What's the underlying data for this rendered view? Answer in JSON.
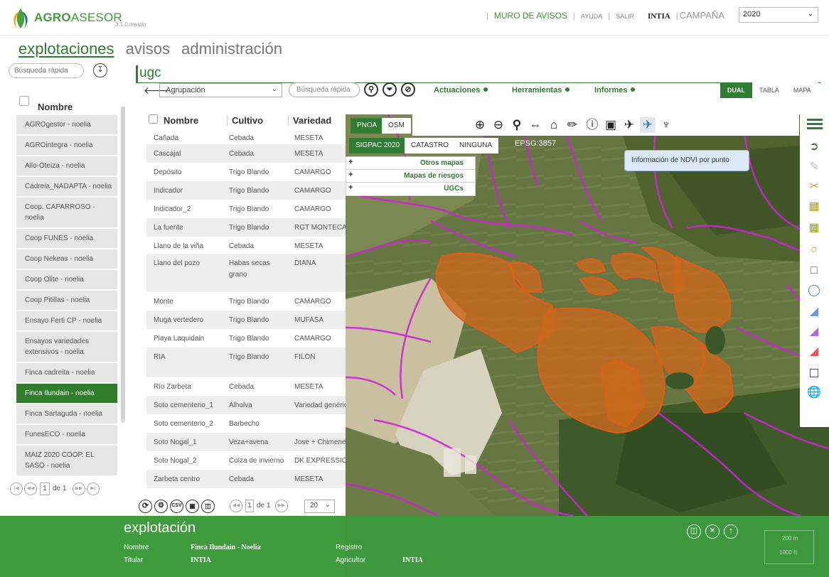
{
  "app": {
    "brand_bold": "AGRO",
    "brand_rest": "ASESOR",
    "version": "3.1.0.mastin"
  },
  "topnav": {
    "muro": "MURO DE AVISOS",
    "ayuda": "AYUDA",
    "salir": "SALIR",
    "org": "INTIA",
    "campaign_label": "CAMPAÑA",
    "campaign_value": "2020",
    "sep": "|"
  },
  "mainnav": {
    "items": [
      "explotaciones",
      "avisos",
      "administración"
    ],
    "active": "explotaciones"
  },
  "left": {
    "search_placeholder": "Búsqueda rápida",
    "header": "Nombre",
    "items": [
      "AGROgestor - noelia",
      "AGROintegra - noelia",
      "Allo-Oteiza - noelia",
      "Cadreia_NADAPTA - noelia",
      "Coop. CAPARROSO - noelia",
      "Coop FUNES - noelia",
      "Coop Nekeas - noelia",
      "Coop Olite - noelia",
      "Coop Pitillas - noelia",
      "Ensayo Ferti CP - noelia",
      "Ensayos variedades extensivos - noelia",
      "Finca cadreita - noelia",
      "Finca Ilundain - noelia",
      "Finca Sartaguda - noelia",
      "FunesECO - noelia",
      "MAIZ 2020 COOP. EL SASO - noelia"
    ],
    "active_index": 12,
    "pager": {
      "page": "1",
      "of_label": "de 1"
    }
  },
  "content": {
    "title": "ugc",
    "agrupacion": "Agrupación",
    "search_placeholder": "Búsqueda rápida",
    "menus": [
      "Actuaciones",
      "Herramientas",
      "Informes"
    ],
    "views": [
      "DUAL",
      "TABLA",
      "MAPA"
    ],
    "active_view": "DUAL"
  },
  "table": {
    "headers": [
      "Nombre",
      "Cultivo",
      "Variedad"
    ],
    "rows": [
      [
        "Cañada",
        "Cebada",
        "MESETA"
      ],
      [
        "Cascajal",
        "Cebada",
        "MESETA"
      ],
      [
        "Depósito",
        "Trigo Blando",
        "CAMARGO"
      ],
      [
        "Indicador",
        "Trigo Blando",
        "CAMARGO"
      ],
      [
        "Indicador_2",
        "Trigo Blando",
        "CAMARGO"
      ],
      [
        "La fuente",
        "Trigo Blando",
        "RGT MONTECARLO"
      ],
      [
        "Llano de la viña",
        "Cebada",
        "MESETA"
      ],
      [
        "Llano del pozo",
        "Habas secas grano",
        "DIANA"
      ],
      [
        "Monte",
        "Trigo Blando",
        "CAMARGO"
      ],
      [
        "Muga vertedero",
        "Trigo Blando",
        "MUFASA"
      ],
      [
        "Playa Laquidain",
        "Trigo Blando",
        "CAMARGO"
      ],
      [
        "RIA",
        "Trigo Blando",
        "FILON"
      ],
      [
        "Río Zarbeta",
        "Cebada",
        "MESETA"
      ],
      [
        "Soto cementerio_1",
        "Alholva",
        "Variedad genérica"
      ],
      [
        "Soto cementerio_2",
        "Barbecho",
        ""
      ],
      [
        "Soto Nogal_1",
        "Veza+avena",
        "Jose + Chimenea"
      ],
      [
        "Soto Nogal_2",
        "Colza de invierno",
        "DK EXPRESSION"
      ],
      [
        "Zarbeta centro",
        "Cebada",
        "MESETA"
      ]
    ],
    "tool_icons": [
      "refresh-icon",
      "settings-icon",
      "csv-icon",
      "save-icon",
      "delete-icon"
    ],
    "csv_label": "CSV",
    "pager": {
      "page": "1",
      "of_label": "de 1"
    },
    "page_size": "20"
  },
  "map": {
    "base_tabs": [
      "PNOA",
      "OSM"
    ],
    "active_base": "PNOA",
    "overlay_tabs": [
      "SIGPAC 2020",
      "CATASTRO",
      "NINGUNA"
    ],
    "active_overlay": "SIGPAC 2020",
    "projection": "EPSG:3857",
    "layers": [
      "Otros mapas",
      "Mapas de riesgos",
      "UGCs"
    ],
    "tooltip": "Información de NDVI por punto",
    "toolbar_icons": [
      "zoom-in-icon",
      "zoom-out-icon",
      "zoom-extent-icon",
      "filter-icon",
      "polygon-icon",
      "ruler-icon",
      "info-icon",
      "binoculars-icon",
      "satellite-icon",
      "ndvi-satellite-icon",
      "drone-icon"
    ],
    "right_icons": [
      "menu-icon",
      "export-icon",
      "edit-icon",
      "cut-icon",
      "map-edit-icon",
      "map-edit-2-icon",
      "compass-icon",
      "frame-icon",
      "circle-target-icon",
      "shape-blue-icon",
      "shape-purple-icon",
      "shape-red-icon",
      "square-icon",
      "globe-icon"
    ],
    "colors": {
      "field_fill": "#c8691e",
      "field_stroke": "#d9531a",
      "parcel_line": "#d020d8"
    }
  },
  "bottom": {
    "title": "explotación",
    "fields": {
      "nombre_label": "Nombre",
      "nombre_value": "Finca Ilundain - Noelia",
      "titular_label": "Titular",
      "titular_value": "INTIA",
      "registro_label": "Registro",
      "registro_value": "",
      "agricultor_label": "Agricultor",
      "agricultor_value": "INTIA"
    },
    "scale": [
      "200 m",
      "1000 ft"
    ]
  },
  "colors": {
    "accent": "#2e7d32",
    "bottom_bar": "#3f9c3d",
    "active_row": "#2f7d2d"
  }
}
